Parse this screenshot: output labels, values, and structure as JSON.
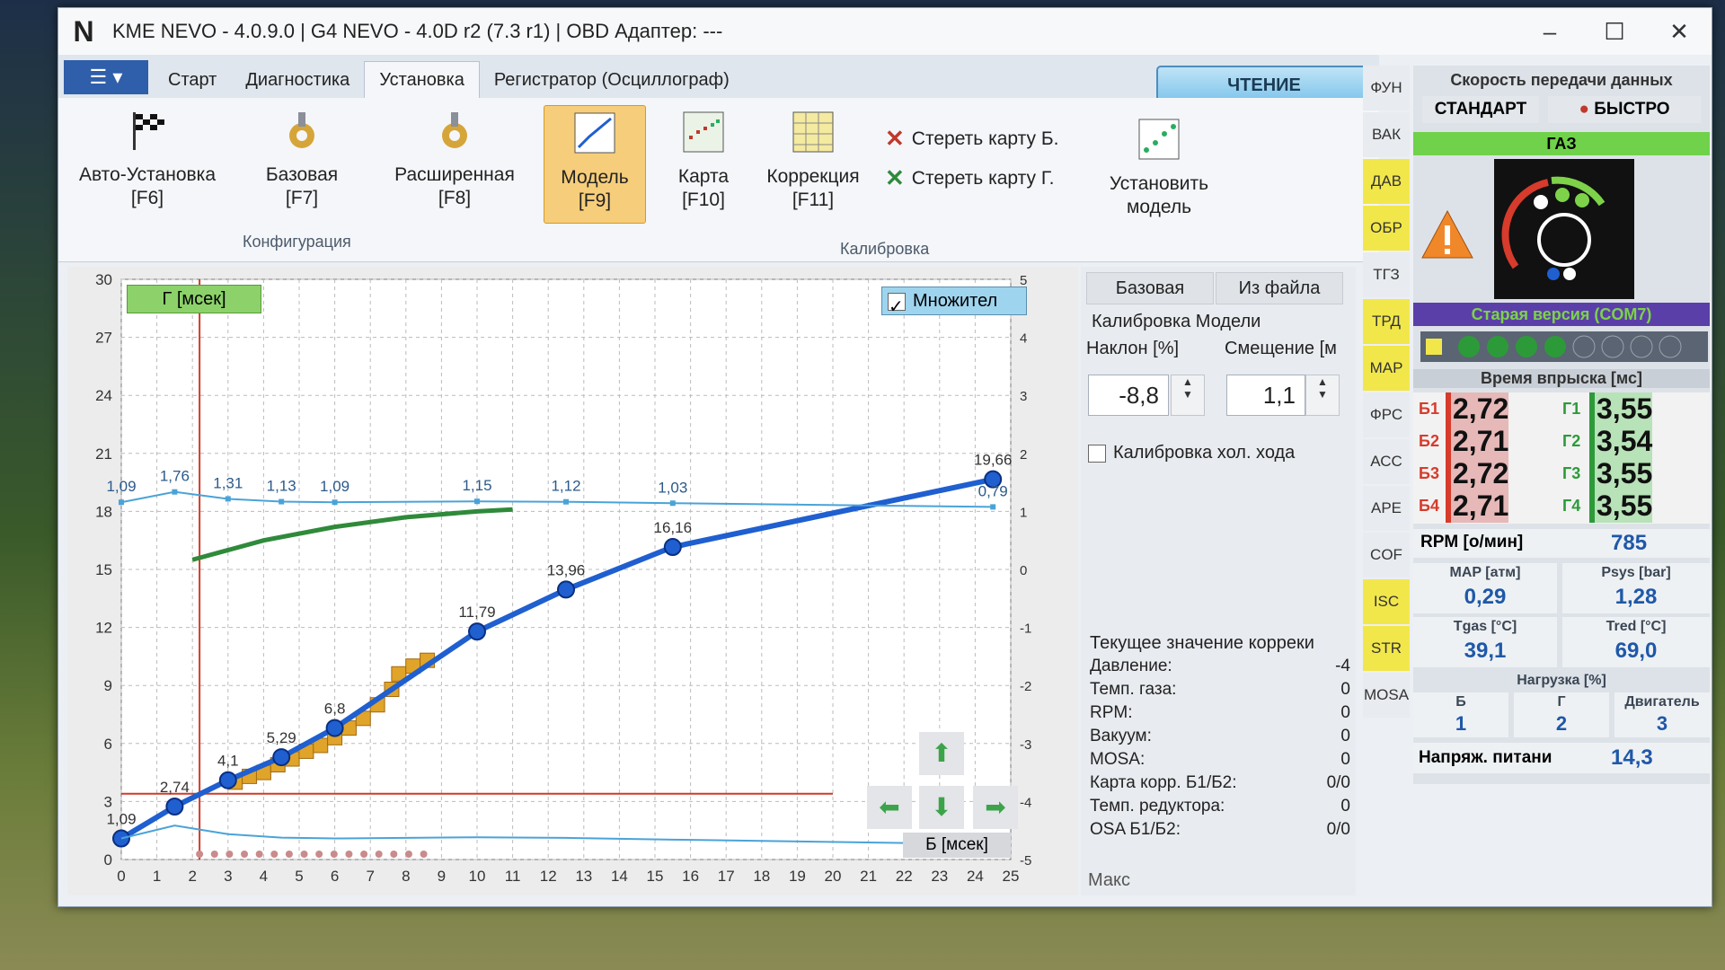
{
  "window": {
    "title": "KME NEVO - 4.0.9.0  |  G4 NEVO - 4.0D r2 (7.3 r1)  |  OBD Адаптер: ---",
    "logo": "N",
    "minimize": "–",
    "maximize": "☐",
    "close": "✕"
  },
  "tabs": [
    "Старт",
    "Диагностика",
    "Установка",
    "Регистратор (Осциллограф)"
  ],
  "read_button": "ЧТЕНИЕ",
  "ribbon": {
    "auto": [
      "Авто-Установка",
      "[F6]"
    ],
    "base": [
      "Базовая",
      "[F7]"
    ],
    "ext": [
      "Расширенная",
      "[F8]"
    ],
    "config_label": "Конфигурация",
    "model": [
      "Модель",
      "[F9]"
    ],
    "map": [
      "Карта",
      "[F10]"
    ],
    "corr": [
      "Коррекция",
      "[F11]"
    ],
    "clear_b": "Стереть карту Б.",
    "clear_g": "Стереть карту Г.",
    "set_model": [
      "Установить",
      "модель"
    ],
    "calib_label": "Калибровка"
  },
  "chart_labels": {
    "ylabel_tag": "Г [мсек]",
    "xlabel_tag": "Б [мсек]",
    "multiplier": "Множител"
  },
  "chart_data": {
    "type": "line",
    "x_ticks": [
      0,
      1,
      2,
      3,
      4,
      5,
      6,
      7,
      8,
      9,
      10,
      11,
      12,
      13,
      14,
      15,
      16,
      17,
      18,
      19,
      20,
      21,
      22,
      23,
      24,
      25
    ],
    "y_left_ticks": [
      0,
      3,
      6,
      9,
      12,
      15,
      18,
      21,
      24,
      27,
      30
    ],
    "y_right_ticks": [
      -5,
      -4,
      -3,
      -2,
      -1,
      0,
      1,
      2,
      3,
      4,
      5
    ],
    "xlim": [
      0,
      25
    ],
    "ylim": [
      0,
      30
    ],
    "y2lim": [
      -5,
      5
    ],
    "series": [
      {
        "color": "#1f5fd0",
        "x": [
          0,
          1.5,
          3,
          4.5,
          6,
          10,
          12.5,
          15.5,
          24.5
        ],
        "y": [
          1.09,
          2.74,
          4.1,
          5.29,
          6.8,
          11.79,
          13.96,
          16.16,
          19.66
        ],
        "labels": [
          "1,09",
          "2,74",
          "4,1",
          "5,29",
          "6,8",
          "11,79",
          "13,96",
          "16,16",
          "19,66"
        ]
      },
      {
        "color": "#4aa3d8",
        "x": [
          0,
          1.5,
          3,
          4.5,
          6,
          10,
          12.5,
          15.5,
          24.5
        ],
        "y": [
          1.09,
          1.76,
          1.31,
          1.13,
          1.09,
          1.15,
          1.12,
          1.03,
          0.79
        ],
        "labels": [
          "1,09",
          "1,76",
          "1,31",
          "1,13",
          "1,09",
          "1,15",
          "1,12",
          "1,03",
          "0,79"
        ]
      },
      {
        "color": "#2f8a3a",
        "x": [
          2,
          4,
          6,
          8,
          10,
          11
        ],
        "y": [
          15.5,
          16.5,
          17.2,
          17.7,
          18.0,
          18.1
        ]
      }
    ],
    "scatter": {
      "color": "#e0a42a",
      "x": [
        3.2,
        3.6,
        4.0,
        4.4,
        4.8,
        5.2,
        5.6,
        6.0,
        6.4,
        6.8,
        7.2,
        7.6,
        7.8,
        8.2,
        8.6
      ],
      "y": [
        4.0,
        4.3,
        4.5,
        4.9,
        5.2,
        5.6,
        5.9,
        6.3,
        6.8,
        7.3,
        8.0,
        8.8,
        9.6,
        10.0,
        10.3
      ]
    },
    "cursor_x": 2.2,
    "hline_y": 3.4,
    "grid": true
  },
  "right_panel": {
    "btn_base": "Базовая",
    "btn_file": "Из файла",
    "title": "Калибровка Модели",
    "slope_label": "Наклон [%]",
    "offset_label": "Смещение [м",
    "slope_value": "-8,8",
    "offset_value": "1,1",
    "idle_label": "Калибровка хол. хода",
    "corr_title": "Текущее значение корреки",
    "rows": [
      {
        "k": "Давление:",
        "v": "-4"
      },
      {
        "k": "Темп. газа:",
        "v": "0"
      },
      {
        "k": "RPM:",
        "v": "0"
      },
      {
        "k": "Вакуум:",
        "v": "0"
      },
      {
        "k": "MOSA:",
        "v": "0"
      },
      {
        "k": "Карта корр. Б1/Б2:",
        "v": "0/0"
      },
      {
        "k": "Темп. редуктора:",
        "v": "0"
      },
      {
        "k": "OSA Б1/Б2:",
        "v": "0/0"
      }
    ],
    "max_label": "Макс"
  },
  "side_buttons": [
    "ФУН",
    "ВАК",
    "ДАВ",
    "ОБР",
    "ТГЗ",
    "ТРД",
    "MAP",
    "ФРС",
    "АСС",
    "АРЕ",
    "COF",
    "ISC",
    "STR",
    "MOSA"
  ],
  "status": {
    "speed_label": "Скорость передачи данных",
    "std": "СТАНДАРТ",
    "fast": "БЫСТРО",
    "gas": "ГАЗ",
    "old_version": "Старая версия (COM7)",
    "inj_title": "Время впрыска [мс]",
    "b": [
      {
        "n": "Б1",
        "v": "2,72"
      },
      {
        "n": "Б2",
        "v": "2,71"
      },
      {
        "n": "Б3",
        "v": "2,72"
      },
      {
        "n": "Б4",
        "v": "2,71"
      }
    ],
    "g": [
      {
        "n": "Г1",
        "v": "3,55"
      },
      {
        "n": "Г2",
        "v": "3,54"
      },
      {
        "n": "Г3",
        "v": "3,55"
      },
      {
        "n": "Г4",
        "v": "3,55"
      }
    ],
    "rpm_label": "RPM [о/мин]",
    "rpm": "785",
    "map_label": "MAP [атм]",
    "map": "0,29",
    "psys_label": "Psys [bar]",
    "psys": "1,28",
    "tgas_label": "Tgas [°C]",
    "tgas": "39,1",
    "tred_label": "Tred [°C]",
    "tred": "69,0",
    "load_label": "Нагрузка [%]",
    "load_b": "Б",
    "load_g": "Г",
    "load_eng": "Двигатель",
    "load_b_v": "1",
    "load_g_v": "2",
    "load_eng_v": "3",
    "volt_label": "Напряж. питани",
    "volt": "14,3"
  }
}
